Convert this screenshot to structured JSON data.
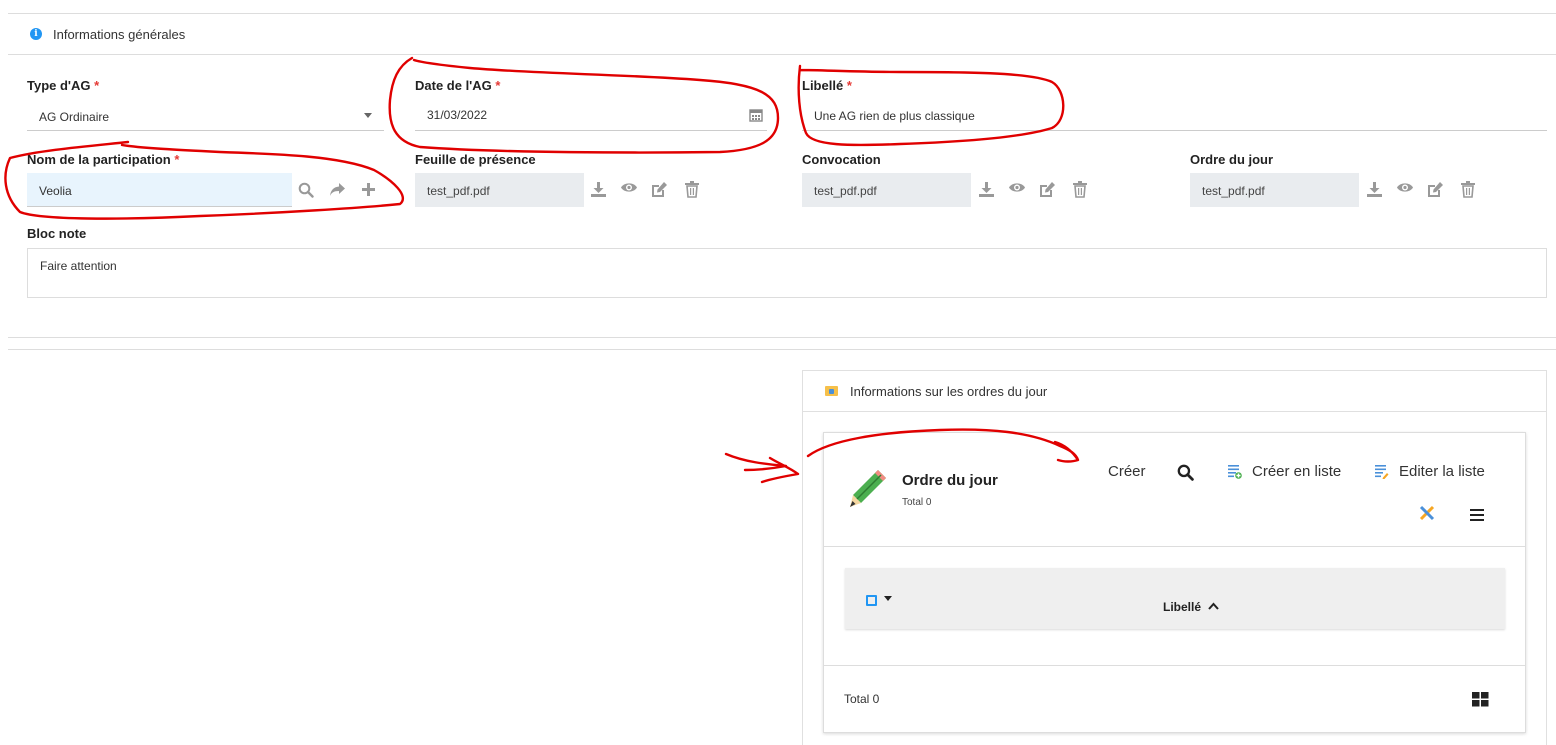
{
  "general": {
    "header": "Informations générales",
    "type_ag": {
      "label": "Type d'AG",
      "required": "*",
      "value": "AG Ordinaire"
    },
    "date_ag": {
      "label": "Date de l'AG",
      "required": "*",
      "value": "31/03/2022"
    },
    "libelle": {
      "label": "Libellé",
      "required": "*",
      "value": "Une AG rien de plus classique"
    },
    "participation": {
      "label": "Nom de la participation",
      "required": "*",
      "value": "Veolia"
    },
    "feuille": {
      "label": "Feuille de présence",
      "value": "test_pdf.pdf"
    },
    "convocation": {
      "label": "Convocation",
      "value": "test_pdf.pdf"
    },
    "ordre": {
      "label": "Ordre du jour",
      "value": "test_pdf.pdf"
    },
    "bloc_note": {
      "label": "Bloc note",
      "value": "Faire attention"
    }
  },
  "agenda": {
    "header": "Informations sur les ordres du jour",
    "card_title": "Ordre du jour",
    "card_total": "Total 0",
    "create_label": "Créer",
    "create_list_label": "Créer en liste",
    "edit_list_label": "Editer la liste",
    "column_label": "Libellé",
    "footer_total": "Total 0"
  },
  "colors": {
    "accent": "#2196f3",
    "required": "#e53935",
    "annotation": "#e00000",
    "field_highlight": "#e8f4fd"
  }
}
